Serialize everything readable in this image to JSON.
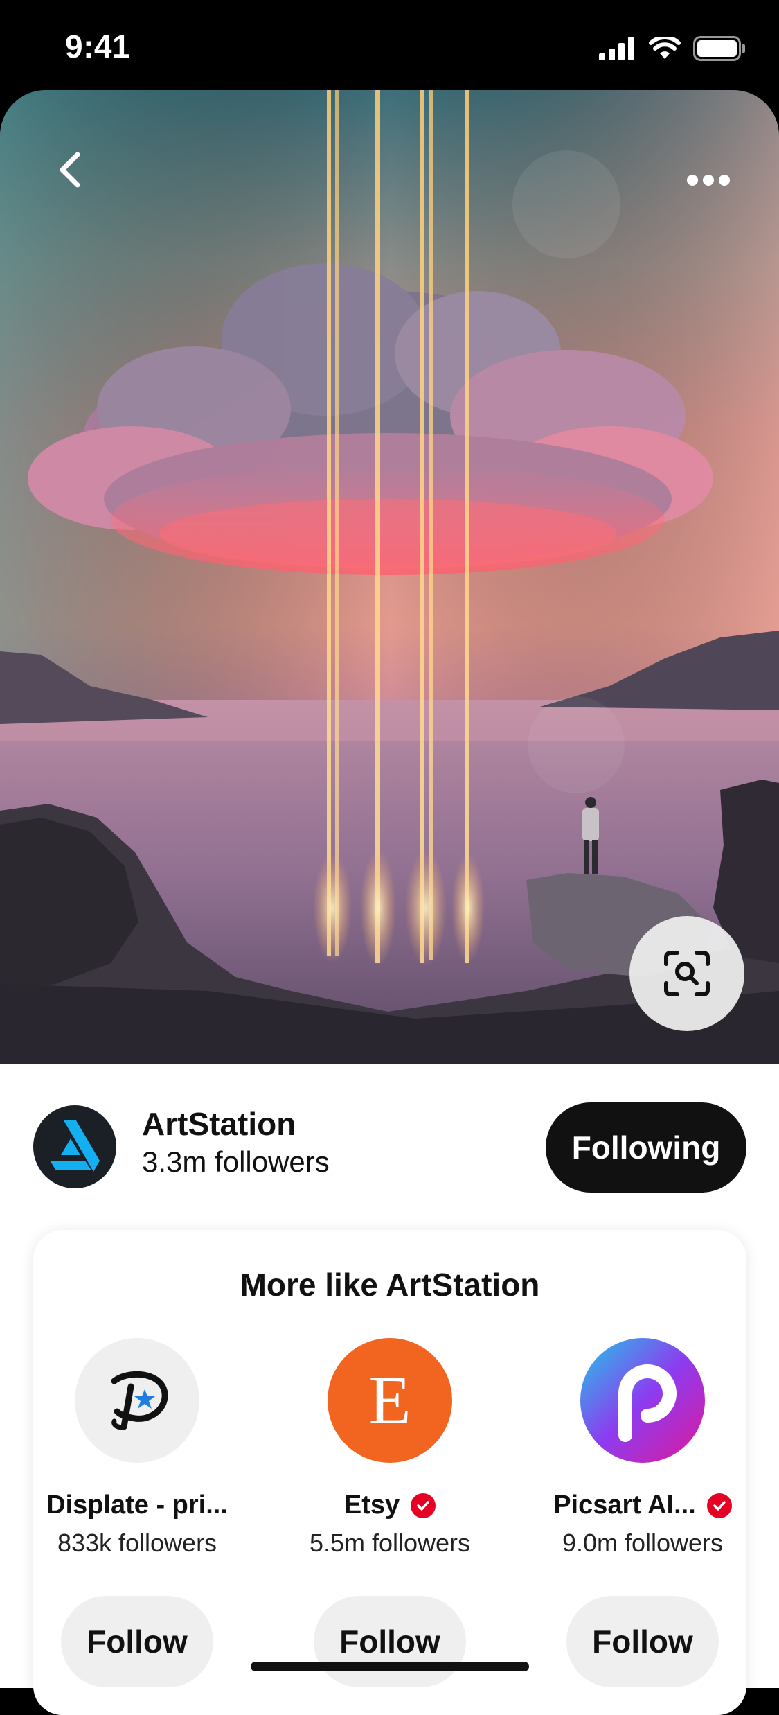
{
  "status_bar": {
    "time": "9:41"
  },
  "pin": {
    "back_icon": "chevron-left-icon",
    "more_icon": "more-horizontal-icon",
    "visual_search_icon": "visual-search-icon"
  },
  "creator": {
    "name": "ArtStation",
    "followers": "3.3m followers",
    "following_label": "Following"
  },
  "more_like": {
    "title": "More like ArtStation",
    "items": [
      {
        "name": "Displate - pri...",
        "followers": "833k followers",
        "verified": false,
        "follow_label": "Follow",
        "avatar_bg": "#efefef"
      },
      {
        "name": "Etsy",
        "followers": "5.5m followers",
        "verified": true,
        "follow_label": "Follow",
        "avatar_bg": "#f16521",
        "avatar_letter": "E"
      },
      {
        "name": "Picsart AI...",
        "followers": "9.0m followers",
        "verified": true,
        "follow_label": "Follow",
        "avatar_bg": "#c21fe0"
      }
    ]
  },
  "colors": {
    "brand_red": "#e60023",
    "button_dark": "#111111",
    "button_light": "#efefef"
  }
}
